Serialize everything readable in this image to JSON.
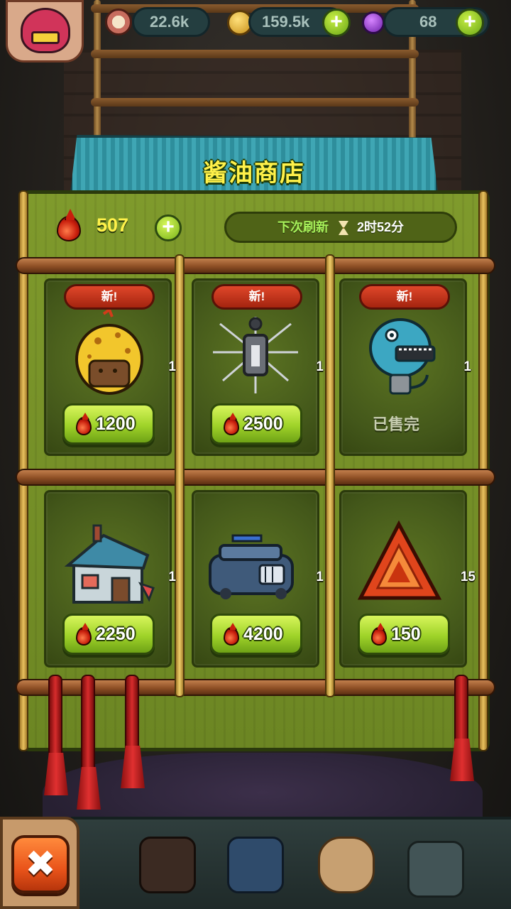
{
  "hud": {
    "eye_icon": "eye-icon",
    "resource1_value": "22.6k",
    "coins_value": "159.5k",
    "potion_value": "68",
    "add_coins_label": "+",
    "add_potion_label": "+"
  },
  "shop": {
    "title": "酱油商店",
    "currency_amount": "507",
    "add_currency_label": "+",
    "refresh_label": "下次刷新",
    "refresh_time": "2时52分"
  },
  "items": [
    {
      "badge": "新!",
      "qty": "1",
      "price": "1200",
      "sold_out": false,
      "icon": "yellow-monster-icon"
    },
    {
      "badge": "新!",
      "qty": "1",
      "price": "2500",
      "sold_out": false,
      "icon": "spiky-creature-icon"
    },
    {
      "badge": "新!",
      "qty": "1",
      "sold_out_label": "已售完",
      "sold_out": true,
      "icon": "blue-fish-monster-icon"
    },
    {
      "qty": "1",
      "price": "2250",
      "icon": "house-building-icon"
    },
    {
      "qty": "1",
      "price": "4200",
      "icon": "armored-tank-icon"
    },
    {
      "qty": "15",
      "price": "150",
      "icon": "red-crystal-shard-icon"
    }
  ],
  "close_label": "✖",
  "colors": {
    "title_yellow": "#fff14a",
    "buy_green": "#9fd329",
    "badge_red": "#c8321a",
    "panel_green": "#7f9a2c"
  }
}
